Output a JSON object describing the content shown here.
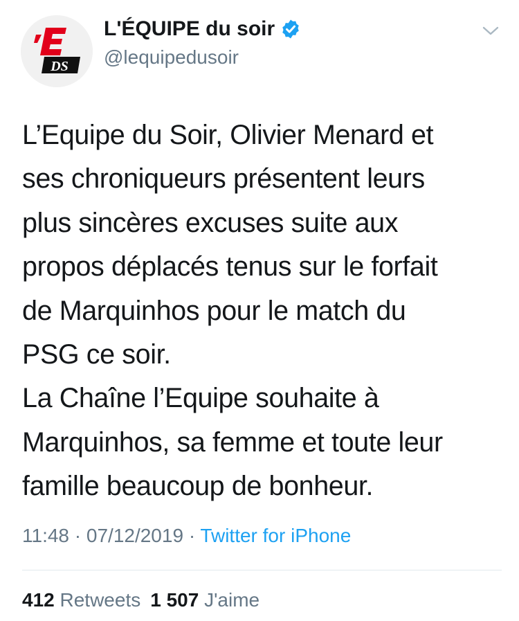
{
  "colors": {
    "text": "#14171a",
    "secondary": "#657786",
    "link": "#1da1f2",
    "divider": "#e1e8ed",
    "logo_red": "#e2001a"
  },
  "author": {
    "name": "L'ÉQUIPE du soir",
    "handle": "@lequipedusoir",
    "avatar_icon": "lequipe-du-soir-logo",
    "verified_icon": "verified-badge-icon",
    "logo_text": "DS"
  },
  "menu_icon": "chevron-down-icon",
  "tweet": {
    "lines": [
      "L’Equipe du Soir, Olivier Menard et",
      "ses chroniqueurs présentent leurs",
      "plus sincères excuses suite aux",
      "propos déplacés tenus sur le forfait",
      "de Marquinhos pour le match du",
      "PSG ce soir.",
      "La Chaîne l’Equipe souhaite à",
      "Marquinhos, sa femme et toute leur",
      "famille beaucoup de bonheur."
    ],
    "time": "11:48",
    "date": "07/12/2019",
    "separator": "·",
    "source": "Twitter for iPhone"
  },
  "stats": {
    "retweets_count": "412",
    "retweets_label": "Retweets",
    "likes_count": "1 507",
    "likes_label": "J'aime"
  }
}
